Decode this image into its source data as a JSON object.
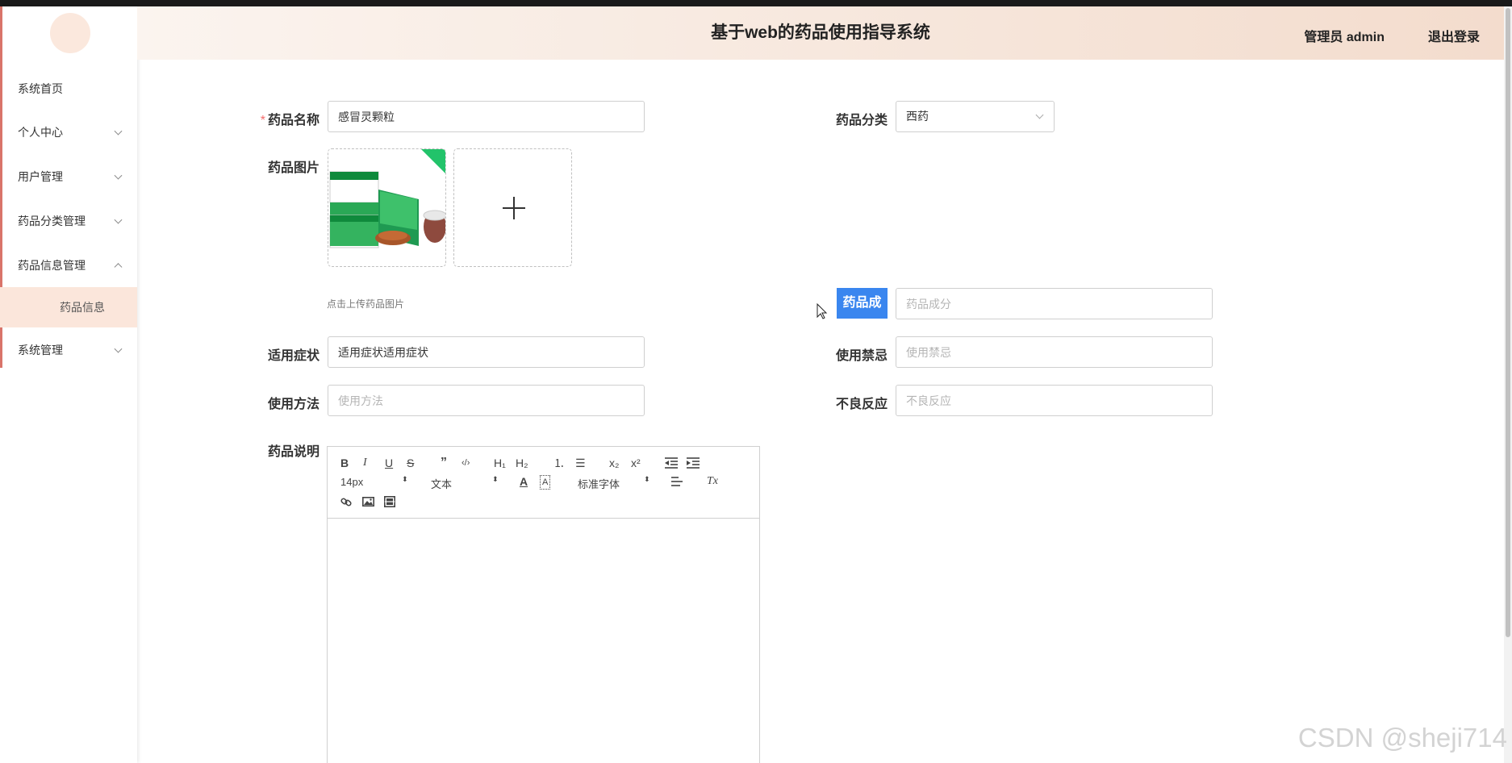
{
  "app": {
    "title": "基于web的药品使用指导系统",
    "user_text": "管理员 admin",
    "logout_label": "退出登录"
  },
  "sidebar": {
    "items": [
      {
        "label": "系统首页"
      },
      {
        "label": "个人中心"
      },
      {
        "label": "用户管理"
      },
      {
        "label": "药品分类管理"
      },
      {
        "label": "药品信息管理"
      },
      {
        "label": "系统管理"
      }
    ],
    "submenu": {
      "label": "药品信息"
    }
  },
  "form": {
    "name": {
      "label": "药品名称",
      "required_mark": "*",
      "value": "感冒灵颗粒"
    },
    "category": {
      "label": "药品分类",
      "value": "西药"
    },
    "image": {
      "label": "药品图片",
      "hint": "点击上传药品图片",
      "plus": "+"
    },
    "ingredients": {
      "label": "药品成分",
      "placeholder": "药品成分"
    },
    "symptoms": {
      "label": "适用症状",
      "value": "适用症状适用症状"
    },
    "contraindications": {
      "label": "使用禁忌",
      "placeholder": "使用禁忌"
    },
    "usage": {
      "label": "使用方法",
      "placeholder": "使用方法"
    },
    "adverse": {
      "label": "不良反应",
      "placeholder": "不良反应"
    },
    "description": {
      "label": "药品说明"
    }
  },
  "editor": {
    "bold": "B",
    "italic": "I",
    "underline": "U",
    "strike": "S",
    "quote": "”",
    "code": "‹/›",
    "h1": "H₁",
    "h2": "H₂",
    "ordered_list": "⒈",
    "bullet_list": "☰",
    "sub": "x₂",
    "sup": "x²",
    "size": "14px",
    "block": "文本",
    "font": "标准字体",
    "caret": "⬍",
    "color": "A",
    "bg_color": "A",
    "clear": "Tx"
  },
  "watermark": "CSDN @sheji714",
  "colors": {
    "accent": "#d9746a",
    "header_from": "#fbf4ef",
    "header_to": "#f3dccd",
    "highlight": "#3a86ef"
  }
}
